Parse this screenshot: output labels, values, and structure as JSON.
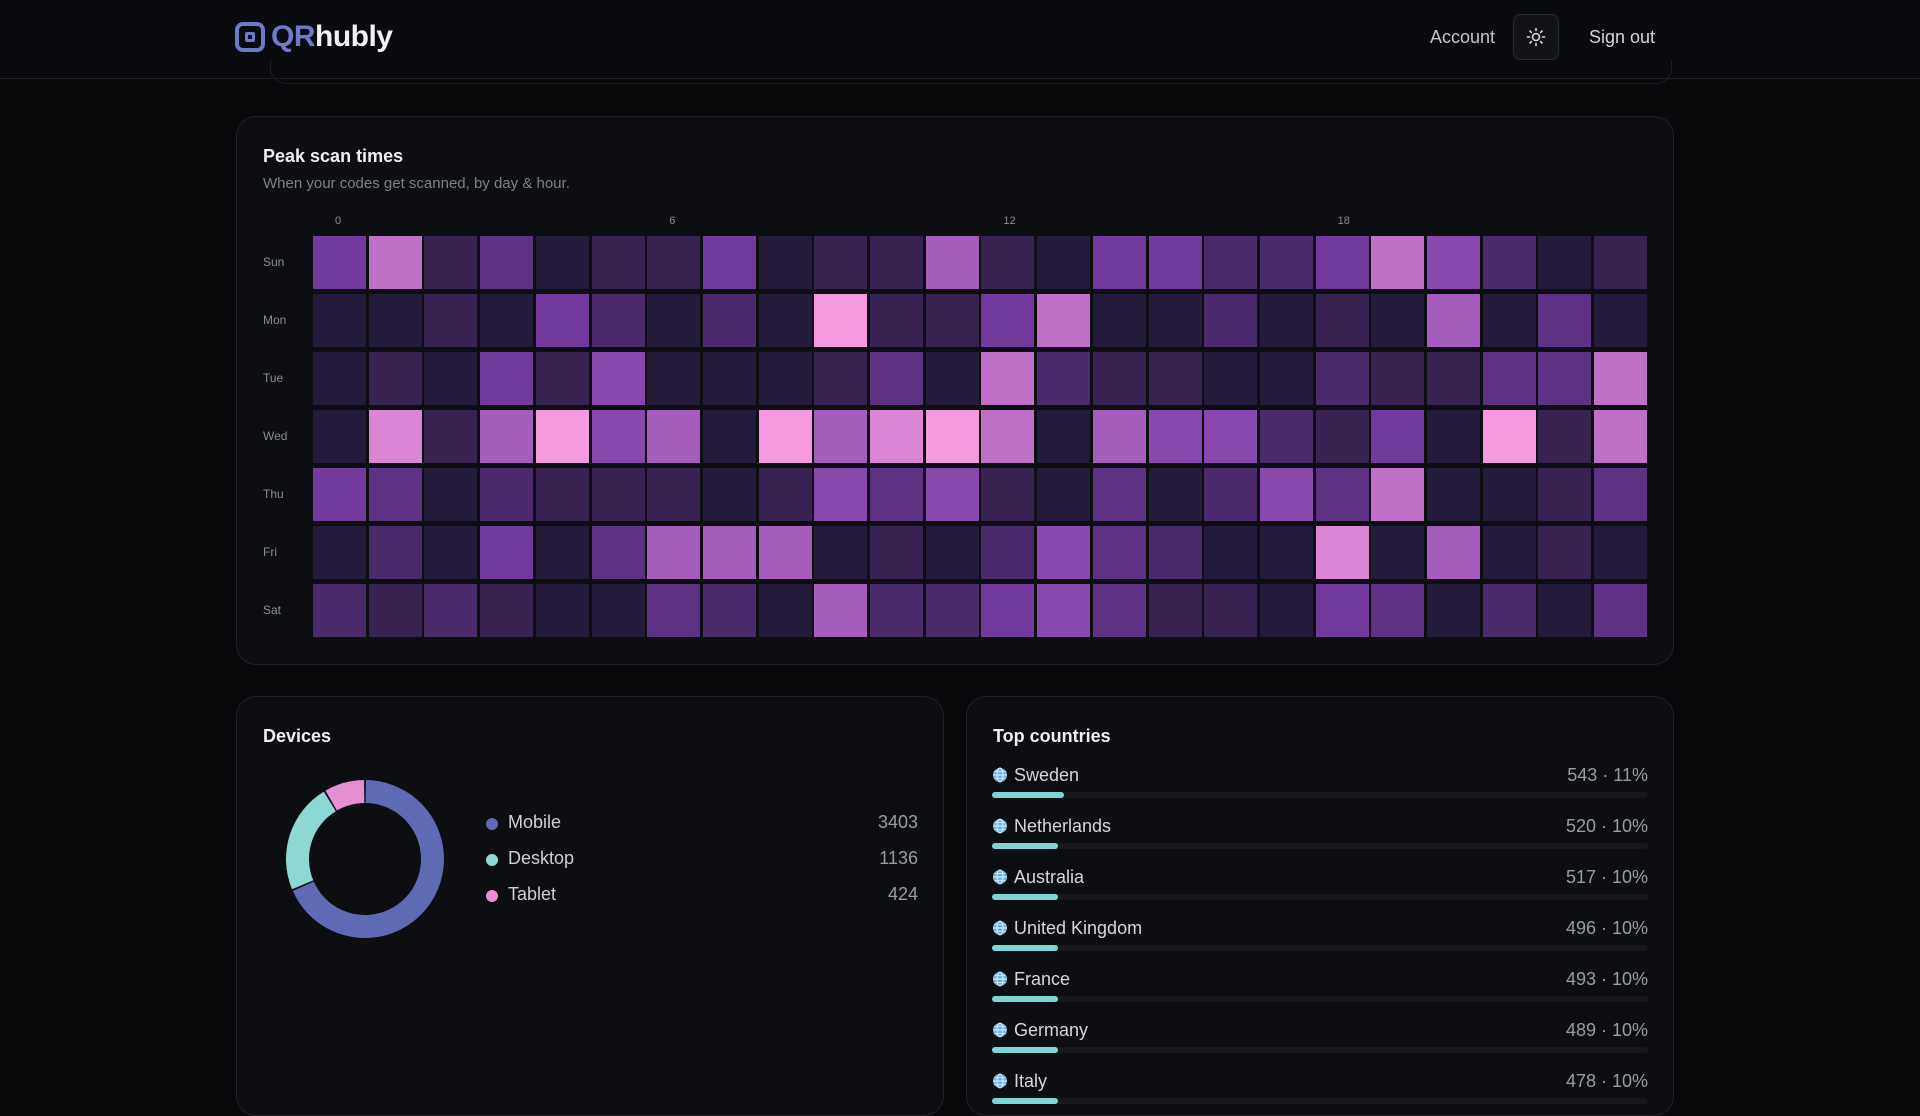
{
  "header": {
    "logo_qr": "QR",
    "logo_rest": "hubly",
    "account_label": "Account",
    "signout_label": "Sign out",
    "theme_icon": "sun-icon"
  },
  "peak": {
    "title": "Peak scan times",
    "subtitle": "When your codes get scanned, by day & hour.",
    "hour_ticks": [
      {
        "hour": 0,
        "label": "0"
      },
      {
        "hour": 6,
        "label": "6"
      },
      {
        "hour": 12,
        "label": "12"
      },
      {
        "hour": 18,
        "label": "18"
      }
    ],
    "days": [
      "Sun",
      "Mon",
      "Tue",
      "Wed",
      "Thu",
      "Fri",
      "Sat"
    ],
    "intensity": [
      [
        5,
        8,
        2,
        4,
        1,
        2,
        2,
        5,
        1,
        2,
        2,
        7,
        2,
        1,
        5,
        5,
        3,
        3,
        5,
        8,
        6,
        3,
        1,
        2
      ],
      [
        1,
        1,
        2,
        1,
        5,
        3,
        1,
        3,
        1,
        10,
        2,
        2,
        5,
        8,
        1,
        1,
        3,
        1,
        2,
        1,
        7,
        1,
        4,
        1
      ],
      [
        1,
        2,
        1,
        5,
        2,
        6,
        1,
        1,
        1,
        2,
        4,
        1,
        8,
        3,
        2,
        2,
        1,
        1,
        3,
        2,
        2,
        4,
        4,
        8
      ],
      [
        1,
        9,
        2,
        7,
        10,
        6,
        7,
        1,
        10,
        7,
        9,
        10,
        8,
        1,
        7,
        6,
        6,
        3,
        2,
        5,
        1,
        10,
        2,
        8
      ],
      [
        5,
        4,
        1,
        3,
        2,
        2,
        2,
        1,
        2,
        6,
        4,
        6,
        2,
        1,
        4,
        1,
        3,
        6,
        4,
        8,
        1,
        1,
        2,
        4
      ],
      [
        1,
        3,
        1,
        5,
        1,
        4,
        7,
        7,
        7,
        1,
        2,
        1,
        3,
        6,
        4,
        3,
        1,
        1,
        9,
        1,
        7,
        1,
        2,
        1
      ],
      [
        3,
        2,
        3,
        2,
        1,
        1,
        4,
        3,
        1,
        7,
        3,
        3,
        5,
        6,
        4,
        2,
        2,
        1,
        5,
        4,
        1,
        3,
        1,
        4
      ]
    ]
  },
  "devices": {
    "title": "Devices",
    "items": [
      {
        "label": "Mobile",
        "value": 3403,
        "color": "#5f69b4"
      },
      {
        "label": "Desktop",
        "value": 1136,
        "color": "#8ed8d3"
      },
      {
        "label": "Tablet",
        "value": 424,
        "color": "#e58ed4"
      }
    ]
  },
  "countries": {
    "title": "Top countries",
    "icon": "globe-icon",
    "items": [
      {
        "name": "Sweden",
        "stat": "543 · 11%",
        "share": 0.11
      },
      {
        "name": "Netherlands",
        "stat": "520 · 10%",
        "share": 0.1
      },
      {
        "name": "Australia",
        "stat": "517 · 10%",
        "share": 0.1
      },
      {
        "name": "United Kingdom",
        "stat": "496 · 10%",
        "share": 0.1
      },
      {
        "name": "France",
        "stat": "493 · 10%",
        "share": 0.1
      },
      {
        "name": "Germany",
        "stat": "489 · 10%",
        "share": 0.1
      },
      {
        "name": "Italy",
        "stat": "478 · 10%",
        "share": 0.1
      }
    ]
  },
  "colors": {
    "accent": "#6e79c9",
    "bar": "#7ed6d2",
    "heat_low": "#241a3a",
    "heat_mid": "#7b3ea8",
    "heat_high": "#f59ae0"
  }
}
